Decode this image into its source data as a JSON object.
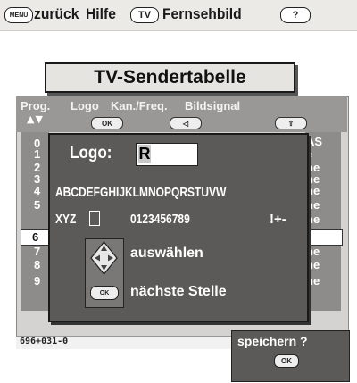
{
  "topbar": {
    "menu_key": "MENU",
    "back_label": "zurück",
    "help_label": "Hilfe",
    "tv_key": "TV",
    "tv_label": "Fernsehbild",
    "help_key": "?"
  },
  "title": "TV-Sendertabelle",
  "table": {
    "headers": [
      "Prog.",
      "Logo",
      "Kan./Freq.",
      "Bildsignal"
    ],
    "partial_header": "AS",
    "sort_arrows": "▲▼",
    "header_keys": [
      "OK",
      "◁",
      "⇧"
    ],
    "left_rows": [
      "0",
      "1",
      "2",
      "3",
      "4",
      "5",
      "6",
      "7",
      "8",
      "9"
    ],
    "selected_row": "6",
    "right_rows": [
      "e",
      "ne",
      "ne",
      "ne",
      "ne",
      "ne",
      "",
      "ne",
      "ne",
      "ne"
    ]
  },
  "dialog": {
    "logo_label": "Logo:",
    "logo_value": "R",
    "alphabet": "ABCDEFGHIJKLMNOPQRSTUVW",
    "xyz": "XYZ",
    "digits": "0123456789",
    "symbols": "!+-",
    "dpad_icon": "direction-pad-icon",
    "ok_key": "OK",
    "action_select": "auswählen",
    "action_next": "nächste Stelle"
  },
  "status_code": "696+031-0",
  "save": {
    "label": "speichern ?",
    "ok_key": "OK"
  }
}
